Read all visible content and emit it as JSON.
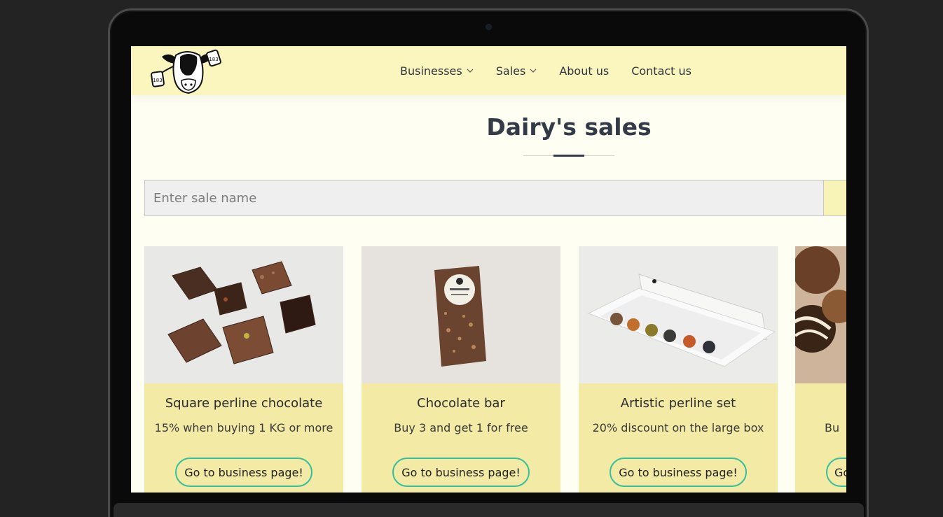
{
  "nav": {
    "items": [
      {
        "label": "Businesses",
        "has_dropdown": true
      },
      {
        "label": "Sales",
        "has_dropdown": true
      },
      {
        "label": "About us",
        "has_dropdown": false
      },
      {
        "label": "Contact us",
        "has_dropdown": false
      }
    ],
    "logo_tags": [
      "183",
      "183"
    ]
  },
  "page": {
    "title": "Dairy's sales"
  },
  "search": {
    "placeholder": "Enter sale name"
  },
  "cards": [
    {
      "title": "Square perline chocolate",
      "description": "15% when buying 1 KG or more",
      "button": "Go to business page!",
      "image": "chocolate-squares"
    },
    {
      "title": "Chocolate bar",
      "description": "Buy 3 and get 1 for free",
      "button": "Go to business page!",
      "image": "chocolate-bar"
    },
    {
      "title": "Artistic perline set",
      "description": "20% discount on the large box",
      "button": "Go to business page!",
      "image": "perline-box"
    },
    {
      "title": "",
      "description": "Bu",
      "button": "Go",
      "image": "truffles"
    }
  ],
  "colors": {
    "navbar": "#fbf6bd",
    "page_background": "#fefef2",
    "card_background": "#f3eaa5",
    "button_border": "#35c09b",
    "title_text": "#333a48"
  }
}
